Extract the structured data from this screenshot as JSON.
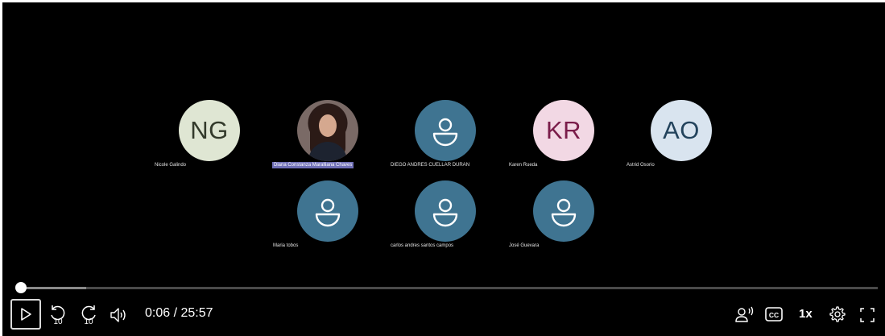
{
  "participants": [
    {
      "name": "Nicole Galindo",
      "initials": "NG",
      "type": "initials-ng"
    },
    {
      "name": "Diana Constanza Maralliana Chaves",
      "initials": "",
      "type": "photo"
    },
    {
      "name": "DIEGO ANDRES CUELLAR DURAN",
      "initials": "",
      "type": "generic"
    },
    {
      "name": "Karen Rueda",
      "initials": "KR",
      "type": "initials-kr"
    },
    {
      "name": "Astrid Osorio",
      "initials": "AO",
      "type": "initials-ao"
    },
    {
      "name": "Maria tobos",
      "initials": "",
      "type": "generic"
    },
    {
      "name": "carlos andres santos campos",
      "initials": "",
      "type": "generic"
    },
    {
      "name": "José Guevara",
      "initials": "",
      "type": "generic"
    }
  ],
  "player": {
    "time_display": "0:06 / 25:57",
    "played_fraction": 0.004,
    "buffered_fraction": 0.08,
    "speed_label": "1x",
    "skip_back_label": "10",
    "skip_forward_label": "10"
  },
  "icons": {
    "play": "play-icon",
    "skip_back": "rewind-10-icon",
    "skip_forward": "forward-10-icon",
    "volume": "volume-icon",
    "audio_description": "audio-description-icon",
    "captions": "captions-icon",
    "settings": "gear-icon",
    "fullscreen": "fullscreen-icon"
  }
}
